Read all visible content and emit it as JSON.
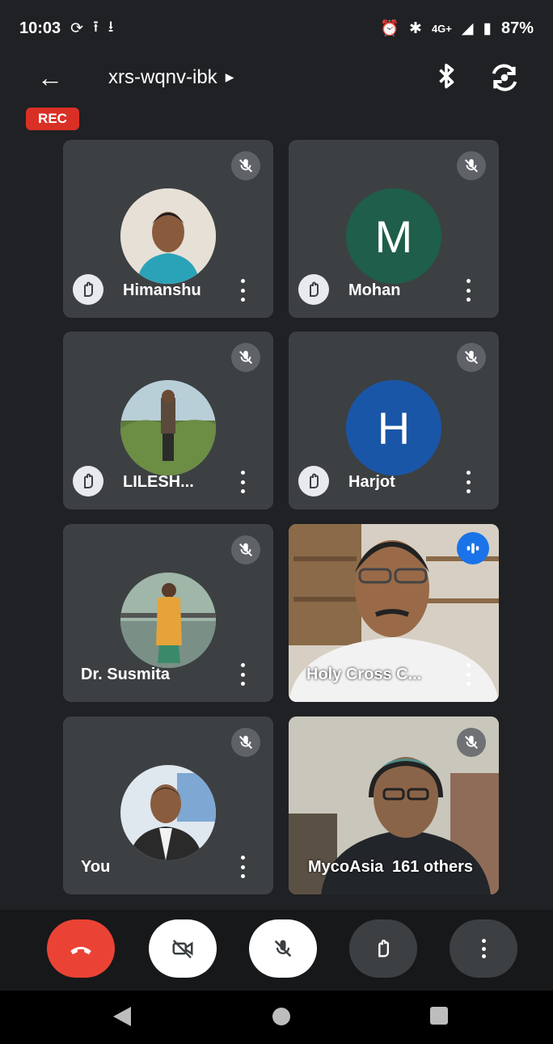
{
  "status_bar": {
    "time": "10:03",
    "network": "4G+",
    "battery": "87%"
  },
  "top_bar": {
    "meeting_code": "xrs-wqnv-ibk"
  },
  "rec_badge": "REC",
  "participants": [
    {
      "name": "Himanshu",
      "initial": "",
      "hand": true
    },
    {
      "name": "Mohan",
      "initial": "M",
      "hand": true,
      "color": "#1e5e4a"
    },
    {
      "name": "LILESH...",
      "initial": "",
      "hand": true
    },
    {
      "name": "Harjot",
      "initial": "H",
      "hand": true,
      "color": "#1a56a8"
    },
    {
      "name": "Dr. Susmita",
      "initial": "",
      "hand": false
    },
    {
      "name": "Holy Cross C...",
      "initial": "",
      "hand": false,
      "speaking": true
    },
    {
      "name": "You",
      "initial": "",
      "hand": false
    },
    {
      "name": "MycoAsia",
      "initial": "",
      "hand": false,
      "others": "161 others"
    }
  ],
  "colors": {
    "end_call": "#ea4335",
    "rec": "#d93025",
    "tile": "#3c4043",
    "speaking": "#1a73e8"
  }
}
